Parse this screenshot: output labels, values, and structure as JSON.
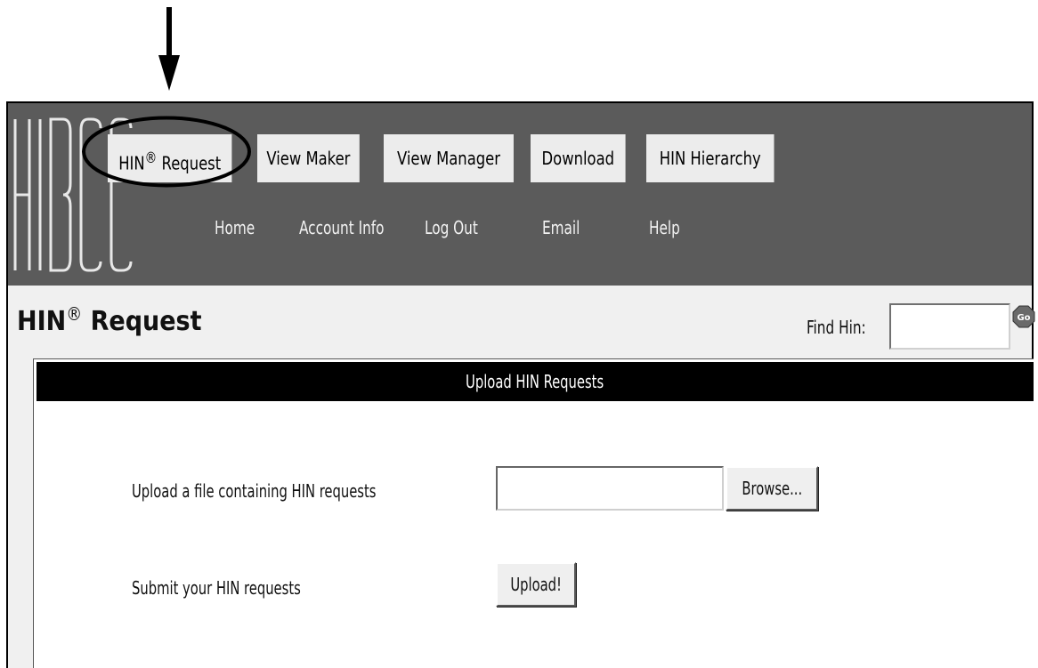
{
  "header": {
    "logo_text": "HIBCC",
    "nav_buttons": [
      {
        "label": "HIN",
        "sup": "®",
        "label_after": " Request"
      },
      {
        "label": "View Maker"
      },
      {
        "label": "View Manager"
      },
      {
        "label": "Download"
      },
      {
        "label": "HIN Hierarchy"
      }
    ],
    "sub_links": [
      "Home",
      "Account Info",
      "Log Out",
      "Email",
      "Help"
    ]
  },
  "page": {
    "title_main": "HIN",
    "title_sup": "®",
    "title_rest": " Request",
    "find_label": "Find Hin:",
    "find_value": "",
    "go_label": "Go"
  },
  "panel": {
    "header": "Upload HIN Requests",
    "upload_file_label": "Upload a file containing HIN requests",
    "file_value": "",
    "browse_label": "Browse...",
    "submit_label": "Submit your HIN requests",
    "upload_button_label": "Upload!"
  },
  "colors": {
    "header_bg": "#5b5b5b",
    "content_bg": "#f0f0f0",
    "panel_header_bg": "#000000",
    "nav_button_bg": "#ececec"
  }
}
